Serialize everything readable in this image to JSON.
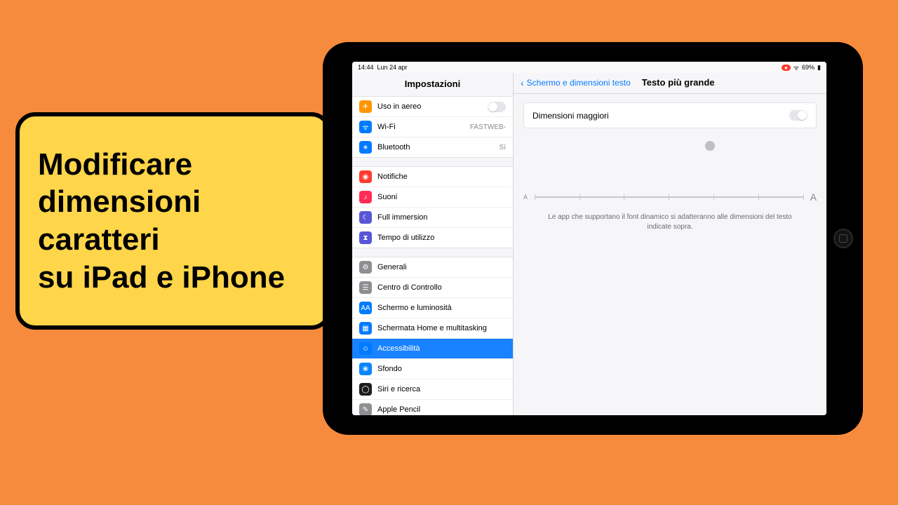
{
  "caption": "Modificare\ndimensioni\ncaratteri\nsu iPad e iPhone",
  "status": {
    "time": "14:44",
    "date": "Lun 24 apr",
    "battery": "69%"
  },
  "sidebar": {
    "title": "Impostazioni",
    "group1": [
      {
        "icon": "airplane-icon",
        "label": "Uso in aereo",
        "value": "",
        "toggle": "off",
        "color": "c-orange"
      },
      {
        "icon": "wifi-icon",
        "label": "Wi-Fi",
        "value": "FASTWEB-",
        "color": "c-blue"
      },
      {
        "icon": "bluetooth-icon",
        "label": "Bluetooth",
        "value": "Sì",
        "color": "c-blue"
      }
    ],
    "group2": [
      {
        "icon": "bell-icon",
        "label": "Notifiche",
        "color": "c-red"
      },
      {
        "icon": "speaker-icon",
        "label": "Suoni",
        "color": "c-pink"
      },
      {
        "icon": "moon-icon",
        "label": "Full immersion",
        "color": "c-purple"
      },
      {
        "icon": "hourglass-icon",
        "label": "Tempo di utilizzo",
        "color": "c-purple"
      }
    ],
    "group3": [
      {
        "icon": "gear-icon",
        "label": "Generali",
        "color": "c-gray"
      },
      {
        "icon": "control-center-icon",
        "label": "Centro di Controllo",
        "color": "c-gray"
      },
      {
        "icon": "text-size-icon",
        "label": "Schermo e luminosità",
        "color": "c-blue"
      },
      {
        "icon": "home-screen-icon",
        "label": "Schermata Home e multitasking",
        "color": "c-blue"
      },
      {
        "icon": "accessibility-icon",
        "label": "Accessibilità",
        "color": "c-blue",
        "selected": true
      },
      {
        "icon": "wallpaper-icon",
        "label": "Sfondo",
        "color": "c-teal"
      },
      {
        "icon": "siri-icon",
        "label": "Siri e ricerca",
        "color": "c-black"
      },
      {
        "icon": "pencil-icon",
        "label": "Apple Pencil",
        "color": "c-gray"
      }
    ]
  },
  "detail": {
    "back_label": "Schermo e dimensioni testo",
    "title": "Testo più grande",
    "larger_sizes_label": "Dimensioni maggiori",
    "slider_min_glyph": "A",
    "slider_max_glyph": "A",
    "footer": "Le app che supportano il font dinamico si adatteranno alle dimensioni del testo indicate sopra."
  }
}
